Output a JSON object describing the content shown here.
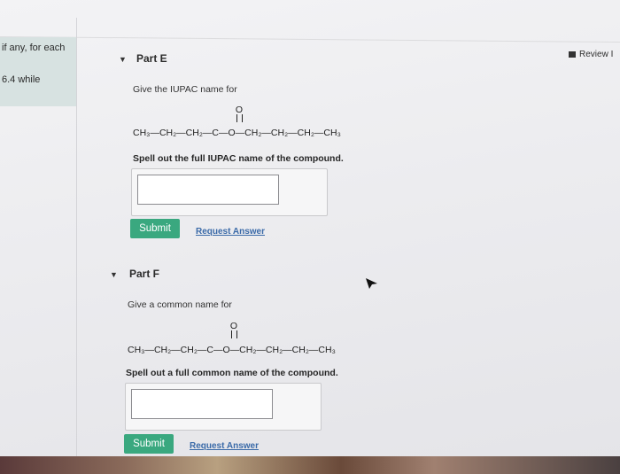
{
  "sidebar": {
    "line1": "if any, for each",
    "line2": "6.4 while"
  },
  "header": {
    "review_label": "Review I"
  },
  "part_e": {
    "title": "Part E",
    "prompt": "Give the IUPAC name for",
    "formula_pre": "CH₃—CH₂—CH₂—C",
    "formula_post": "—O—CH₂—CH₂—CH₂—CH₃",
    "carbonyl_o": "O",
    "instruction": "Spell out the full IUPAC name of the compound.",
    "answer_value": "",
    "submit_label": "Submit",
    "request_label": "Request Answer"
  },
  "part_f": {
    "title": "Part F",
    "prompt": "Give a common name for",
    "formula_pre": "CH₃—CH₂—CH₂—C",
    "formula_post": "—O—CH₂—CH₂—CH₂—CH₃",
    "carbonyl_o": "O",
    "instruction": "Spell out a full common name of the compound.",
    "answer_value": "",
    "submit_label": "Submit",
    "request_label": "Request Answer"
  },
  "colors": {
    "submit": "#3aa87f",
    "link": "#3a6aa8",
    "sidebar_bg": "#d7e2e1"
  }
}
